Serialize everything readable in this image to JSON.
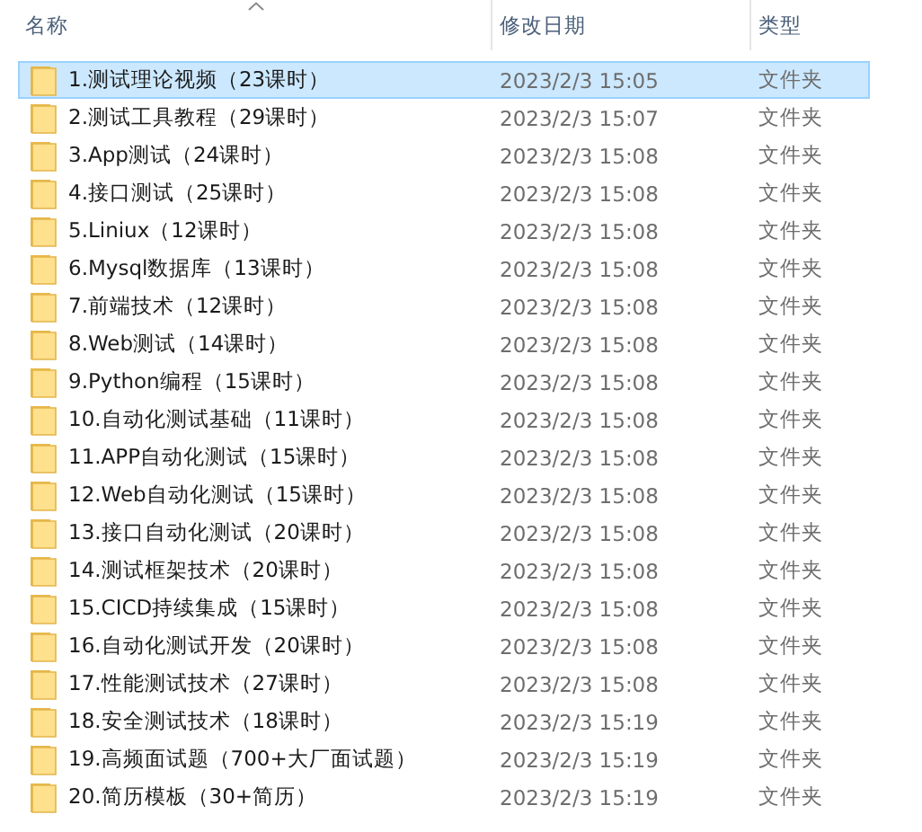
{
  "columns": [
    {
      "label": "名称",
      "sorted": true
    },
    {
      "label": "修改日期",
      "sorted": false
    },
    {
      "label": "类型",
      "sorted": false
    }
  ],
  "rows": [
    {
      "name": "1.测试理论视频（23课时）",
      "date": "2023/2/3 15:05",
      "type": "文件夹",
      "selected": true
    },
    {
      "name": "2.测试工具教程（29课时）",
      "date": "2023/2/3 15:07",
      "type": "文件夹",
      "selected": false
    },
    {
      "name": "3.App测试（24课时）",
      "date": "2023/2/3 15:08",
      "type": "文件夹",
      "selected": false
    },
    {
      "name": "4.接口测试（25课时）",
      "date": "2023/2/3 15:08",
      "type": "文件夹",
      "selected": false
    },
    {
      "name": "5.Liniux（12课时）",
      "date": "2023/2/3 15:08",
      "type": "文件夹",
      "selected": false
    },
    {
      "name": "6.Mysql数据库（13课时）",
      "date": "2023/2/3 15:08",
      "type": "文件夹",
      "selected": false
    },
    {
      "name": "7.前端技术（12课时）",
      "date": "2023/2/3 15:08",
      "type": "文件夹",
      "selected": false
    },
    {
      "name": "8.Web测试（14课时）",
      "date": "2023/2/3 15:08",
      "type": "文件夹",
      "selected": false
    },
    {
      "name": "9.Python编程（15课时）",
      "date": "2023/2/3 15:08",
      "type": "文件夹",
      "selected": false
    },
    {
      "name": "10.自动化测试基础（11课时）",
      "date": "2023/2/3 15:08",
      "type": "文件夹",
      "selected": false
    },
    {
      "name": "11.APP自动化测试（15课时）",
      "date": "2023/2/3 15:08",
      "type": "文件夹",
      "selected": false
    },
    {
      "name": "12.Web自动化测试（15课时）",
      "date": "2023/2/3 15:08",
      "type": "文件夹",
      "selected": false
    },
    {
      "name": "13.接口自动化测试（20课时）",
      "date": "2023/2/3 15:08",
      "type": "文件夹",
      "selected": false
    },
    {
      "name": "14.测试框架技术（20课时）",
      "date": "2023/2/3 15:08",
      "type": "文件夹",
      "selected": false
    },
    {
      "name": "15.CICD持续集成（15课时）",
      "date": "2023/2/3 15:08",
      "type": "文件夹",
      "selected": false
    },
    {
      "name": "16.自动化测试开发（20课时）",
      "date": "2023/2/3 15:08",
      "type": "文件夹",
      "selected": false
    },
    {
      "name": "17.性能测试技术（27课时）",
      "date": "2023/2/3 15:08",
      "type": "文件夹",
      "selected": false
    },
    {
      "name": "18.安全测试技术（18课时）",
      "date": "2023/2/3 15:19",
      "type": "文件夹",
      "selected": false
    },
    {
      "name": "19.高频面试题（700+大厂面试题）",
      "date": "2023/2/3 15:19",
      "type": "文件夹",
      "selected": false
    },
    {
      "name": "20.简历模板（30+简历）",
      "date": "2023/2/3 15:19",
      "type": "文件夹",
      "selected": false
    }
  ]
}
